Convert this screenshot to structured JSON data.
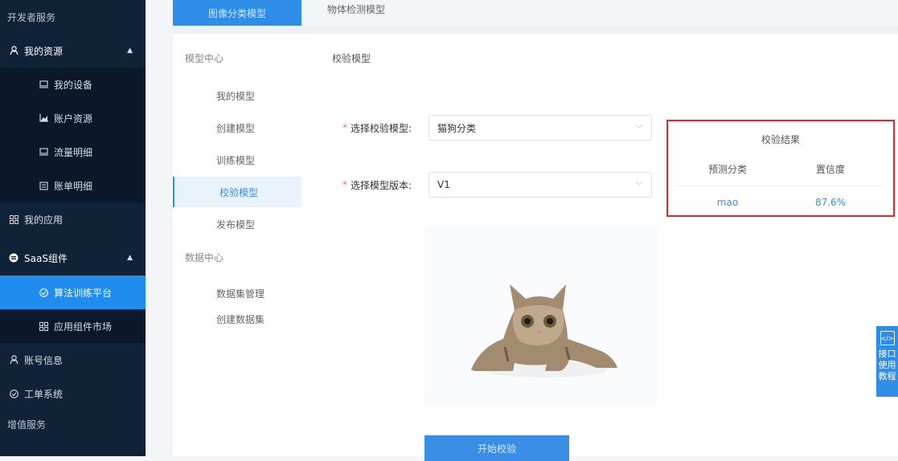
{
  "sidebar": {
    "section_dev": "开发者服务",
    "my_resources": "我的资源",
    "my_devices": "我的设备",
    "account_resources": "账户资源",
    "traffic_details": "流量明细",
    "bill_details": "账单明细",
    "my_apps": "我的应用",
    "saas_components": "SaaS组件",
    "algo_platform": "算法训练平台",
    "app_market": "应用组件市场",
    "account_info": "账号信息",
    "ticket_system": "工单系统",
    "section_value_added": "增值服务"
  },
  "tabs": {
    "image_classify": "图像分类模型",
    "object_detect": "物体检测模型"
  },
  "left_menu": {
    "model_center": "模型中心",
    "my_models": "我的模型",
    "create_model": "创建模型",
    "train_model": "训练模型",
    "verify_model": "校验模型",
    "publish_model": "发布模型",
    "data_center": "数据中心",
    "dataset_manage": "数据集管理",
    "create_dataset": "创建数据集"
  },
  "breadcrumb": "校验模型",
  "form": {
    "select_model_label": "选择校验模型:",
    "select_model_value": "猫狗分类",
    "select_version_label": "选择模型版本:",
    "select_version_value": "V1"
  },
  "start_button": "开始校验",
  "result": {
    "title": "校验结果",
    "col_class": "预测分类",
    "col_confidence": "置信度",
    "pred_class": "mao",
    "confidence": "87.6%"
  },
  "help_float": {
    "icon": "</>",
    "text": "接口使用教程"
  },
  "colors": {
    "sidebar_bg": "#0f2238",
    "accent": "#3a8ee6",
    "highlight_border": "#e5262b"
  },
  "icons": [
    "user-icon",
    "device-icon",
    "chart-icon",
    "flow-icon",
    "bill-icon",
    "apps-icon",
    "saas-icon",
    "algo-icon",
    "market-icon",
    "account-icon",
    "ticket-icon",
    "cat-image"
  ]
}
